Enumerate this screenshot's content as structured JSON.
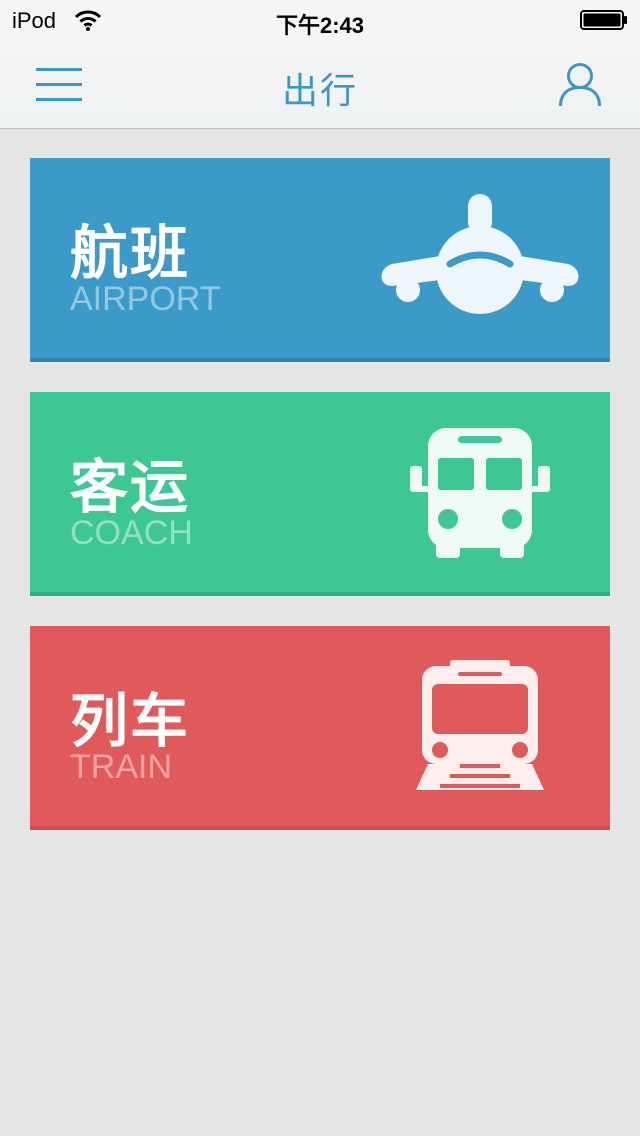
{
  "status_bar": {
    "carrier": "iPod",
    "time": "下午2:43"
  },
  "nav": {
    "title": "出行",
    "menu_icon": "hamburger-menu-icon",
    "user_icon": "user-profile-icon"
  },
  "cards": [
    {
      "title": "航班",
      "subtitle": "AIRPORT",
      "icon": "airplane-icon",
      "color": "#3c9ac9"
    },
    {
      "title": "客运",
      "subtitle": "COACH",
      "icon": "bus-icon",
      "color": "#3dc794"
    },
    {
      "title": "列车",
      "subtitle": "TRAIN",
      "icon": "train-icon",
      "color": "#e05a5c"
    }
  ]
}
